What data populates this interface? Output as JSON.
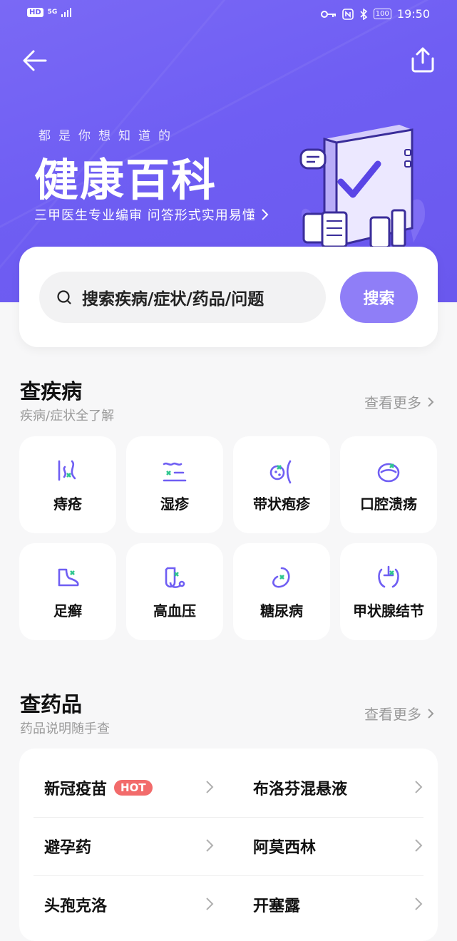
{
  "status_bar": {
    "left_badge": "HD",
    "network": "5G",
    "time": "19:50",
    "battery": "100"
  },
  "header": {
    "tagline": "都是你想知道的",
    "title": "健康百科",
    "subtitle": "三甲医生专业编审 问答形式实用易懂"
  },
  "search": {
    "placeholder": "搜索疾病/症状/药品/问题",
    "button_label": "搜索"
  },
  "diseases": {
    "title": "查疾病",
    "subtitle": "疾病/症状全了解",
    "more_label": "查看更多",
    "items": [
      {
        "label": "痔疮",
        "icon": "hemorrhoid-icon"
      },
      {
        "label": "湿疹",
        "icon": "eczema-icon"
      },
      {
        "label": "带状疱疹",
        "icon": "herpes-icon"
      },
      {
        "label": "口腔溃疡",
        "icon": "mouth-ulcer-icon"
      },
      {
        "label": "足癣",
        "icon": "foot-icon"
      },
      {
        "label": "高血压",
        "icon": "blood-pressure-icon"
      },
      {
        "label": "糖尿病",
        "icon": "diabetes-icon"
      },
      {
        "label": "甲状腺结节",
        "icon": "thyroid-icon"
      }
    ]
  },
  "drugs": {
    "title": "查药品",
    "subtitle": "药品说明随手查",
    "more_label": "查看更多",
    "items": [
      {
        "label": "新冠疫苗",
        "badge": "HOT"
      },
      {
        "label": "布洛芬混悬液"
      },
      {
        "label": "避孕药"
      },
      {
        "label": "阿莫西林"
      },
      {
        "label": "头孢克洛"
      },
      {
        "label": "开塞露"
      }
    ]
  },
  "colors": {
    "primary": "#6f5ef3",
    "button": "#8f7ef7",
    "accent_green": "#2fc68f",
    "hot": "#f26b6b"
  }
}
